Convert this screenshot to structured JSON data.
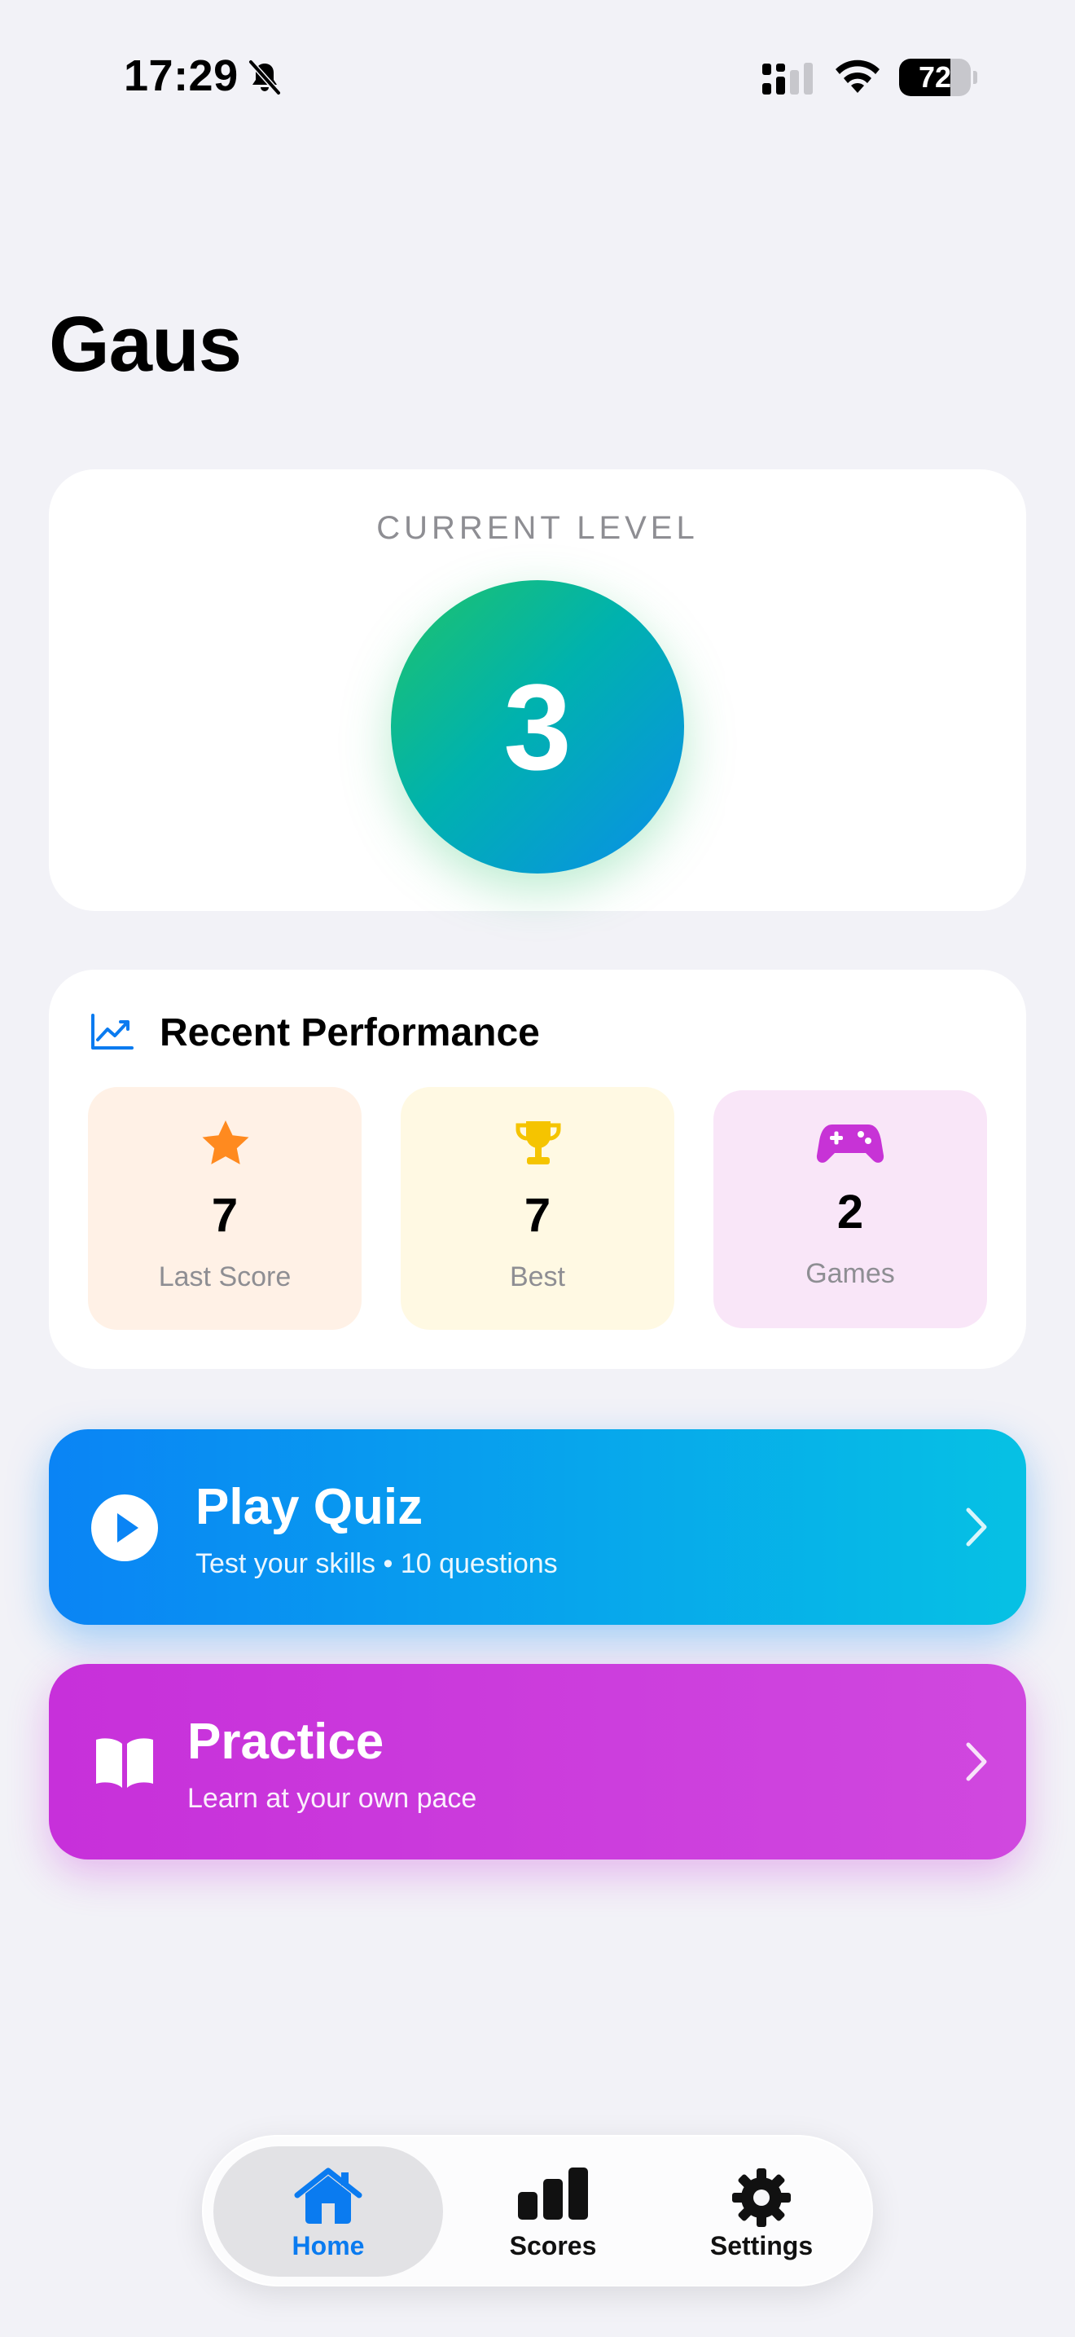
{
  "status_bar": {
    "time": "17:29",
    "battery_level": "72",
    "battery_fraction": 0.72
  },
  "header": {
    "title": "Gaus"
  },
  "level_card": {
    "label": "CURRENT LEVEL",
    "level": "3"
  },
  "performance": {
    "title": "Recent Performance",
    "stats": [
      {
        "icon": "star-icon",
        "value": "7",
        "label": "Last Score",
        "color": "#FF8A1F"
      },
      {
        "icon": "trophy-icon",
        "value": "7",
        "label": "Best",
        "color": "#F5C400"
      },
      {
        "icon": "gamepad-icon",
        "value": "2",
        "label": "Games",
        "color": "#C733D6"
      }
    ]
  },
  "actions": {
    "play_quiz": {
      "title": "Play Quiz",
      "subtitle": "Test your skills • 10 questions",
      "icon": "play-icon"
    },
    "practice": {
      "title": "Practice",
      "subtitle": "Learn at your own pace",
      "icon": "book-icon"
    }
  },
  "tab_bar": {
    "tabs": [
      {
        "label": "Home",
        "icon": "house-icon",
        "selected": true
      },
      {
        "label": "Scores",
        "icon": "bar-chart-icon",
        "selected": false
      },
      {
        "label": "Settings",
        "icon": "gear-icon",
        "selected": false
      }
    ]
  },
  "colors": {
    "accent": "#0A7BF0",
    "background": "#F2F2F7",
    "level_gradient": [
      "#1FC36A",
      "#0A8EEA"
    ],
    "quiz_gradient": [
      "#0A84F5",
      "#06C1E4"
    ],
    "practice_gradient": [
      "#C730DA",
      "#D048DF"
    ]
  }
}
